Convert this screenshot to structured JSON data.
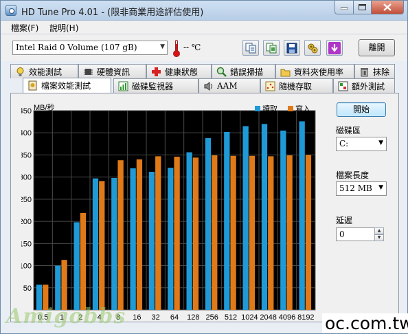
{
  "window": {
    "title": "HD Tune Pro 4.01 - (限非商業用途評估使用)"
  },
  "menu": [
    {
      "label": "檔案(F)"
    },
    {
      "label": "說明(H)"
    }
  ],
  "toolbar": {
    "drive": "Intel  Raid 0 Volume (107 gB)",
    "temperature": "-- ℃",
    "buttons": [
      "copy-text-icon",
      "copy-screenshot-icon",
      "save-icon",
      "options-icon",
      "download-icon"
    ],
    "exit_label": "離開"
  },
  "tabs_row1": [
    {
      "label": "效能測試",
      "icon": "lightbulb-icon"
    },
    {
      "label": "硬體資訊",
      "icon": "chip-icon"
    },
    {
      "label": "健康狀態",
      "icon": "health-cross-icon"
    },
    {
      "label": "錯誤掃描",
      "icon": "magnifier-icon"
    },
    {
      "label": "資料夾使用率",
      "icon": "folder-icon"
    },
    {
      "label": "抹除",
      "icon": "trash-icon"
    }
  ],
  "tabs_row2": [
    {
      "label": "檔案效能測試",
      "icon": "file-benchmark-icon",
      "active": true
    },
    {
      "label": "磁碟監視器",
      "icon": "monitor-bars-icon",
      "active": false
    },
    {
      "label": "AAM",
      "icon": "speaker-icon",
      "active": false
    },
    {
      "label": "隨機存取",
      "icon": "random-access-icon",
      "active": false
    },
    {
      "label": "額外測試",
      "icon": "extra-tests-icon",
      "active": false
    }
  ],
  "side": {
    "start_label": "開始",
    "drive_label": "磁碟區",
    "drive_value": "C:",
    "length_label": "檔案長度",
    "length_value": "512 MB",
    "delay_label": "延遲",
    "delay_value": "0"
  },
  "chart_data": {
    "type": "bar",
    "ylabel": "MB/秒",
    "ylim": [
      0,
      450
    ],
    "yticks": [
      50,
      100,
      150,
      200,
      250,
      300,
      350,
      400,
      450
    ],
    "categories": [
      "0.5",
      "1",
      "2",
      "4",
      "8",
      "16",
      "32",
      "64",
      "128",
      "256",
      "512",
      "1024",
      "2048",
      "4096",
      "8192"
    ],
    "series": [
      {
        "name": "讀取",
        "color": "#1f9ad6",
        "values": [
          57,
          100,
          198,
          297,
          298,
          320,
          312,
          321,
          356,
          388,
          402,
          415,
          420,
          405,
          426
        ]
      },
      {
        "name": "寫入",
        "color": "#e07a18",
        "values": [
          57,
          113,
          219,
          291,
          338,
          340,
          347,
          346,
          344,
          349,
          348,
          348,
          347,
          349,
          350
        ]
      }
    ],
    "legend_position": "top-right",
    "grid": true
  },
  "overlay": {
    "watermark": "Amigobbs",
    "site": "oc.com.tw"
  }
}
